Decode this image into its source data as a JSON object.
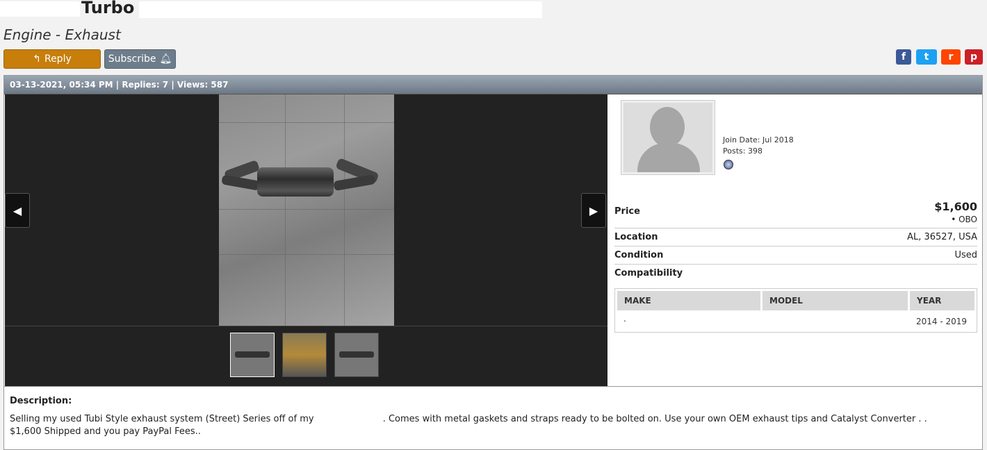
{
  "thread": {
    "title_visible": "Turbo",
    "subtitle": "Engine - Exhaust"
  },
  "actions": {
    "reply_label": "Reply",
    "subscribe_label": "Subscribe"
  },
  "share": {
    "facebook": "f",
    "twitter": "t",
    "reddit": "r",
    "pinterest": "p"
  },
  "post": {
    "header": "03-13-2021, 05:34 PM | Replies: 7 | Views: 587"
  },
  "gallery": {
    "prev_icon": "◀",
    "next_icon": "▶",
    "thumbnails": 3
  },
  "user": {
    "join_date": "Join Date: Jul 2018",
    "posts": "Posts: 398"
  },
  "listing": {
    "price_label": "Price",
    "price": "$1,600",
    "obo": "• OBO",
    "location_label": "Location",
    "location": "AL, 36527, USA",
    "condition_label": "Condition",
    "condition": "Used",
    "compat_label": "Compatibility",
    "compat_headers": [
      "MAKE",
      "MODEL",
      "YEAR"
    ],
    "compat_row": {
      "make": ".",
      "model": "",
      "year": "2014 - 2019"
    }
  },
  "description": {
    "title": "Description:",
    "line1a": "Selling my used  Tubi Style exhaust system  (Street) Series off of my",
    "line1b": ". Comes with metal gaskets and straps ready to be bolted on. Use your own OEM exhaust tips and Catalyst Converter . .",
    "line2": "$1,600 Shipped and you pay PayPal Fees.."
  },
  "colors": {
    "reply": "#c77e0b",
    "subscribe": "#6d7d8b",
    "price": "#b8001f"
  }
}
